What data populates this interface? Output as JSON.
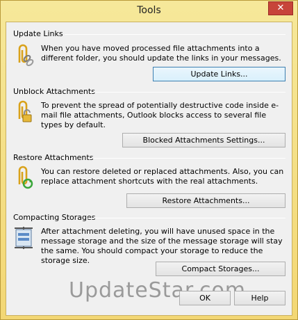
{
  "window": {
    "title": "Tools",
    "close_glyph": "✕"
  },
  "sections": {
    "update_links": {
      "title": "Update Links",
      "description": "When you have moved processed file attachments into a different folder, you should update the links in your messages.",
      "button": "Update Links...",
      "icon": "paperclip-chain-icon"
    },
    "unblock": {
      "title": "Unblock Attachments",
      "description": "To prevent the spread of potentially destructive code inside e-mail file attachments, Outlook blocks access to several file types by default.",
      "button": "Blocked Attachments Settings...",
      "icon": "paperclip-lock-icon"
    },
    "restore": {
      "title": "Restore Attachments",
      "description": "You can restore deleted or replaced attachments. Also, you can replace attachment shortcuts with the real attachments.",
      "button": "Restore Attachments...",
      "icon": "paperclip-restore-icon"
    },
    "compact": {
      "title": "Compacting Storages",
      "description": "After attachment deleting, you will have unused space in the message storage and the size of the message storage will stay the same. You should compact your storage to reduce the storage size.",
      "button": "Compact Storages...",
      "icon": "storage-compress-icon"
    }
  },
  "footer": {
    "ok": "OK",
    "help": "Help"
  },
  "watermark": "UpdateStar.com",
  "colors": {
    "titlebar": "#f3d774",
    "close": "#c7443a",
    "accent": "#3c7fb1"
  }
}
